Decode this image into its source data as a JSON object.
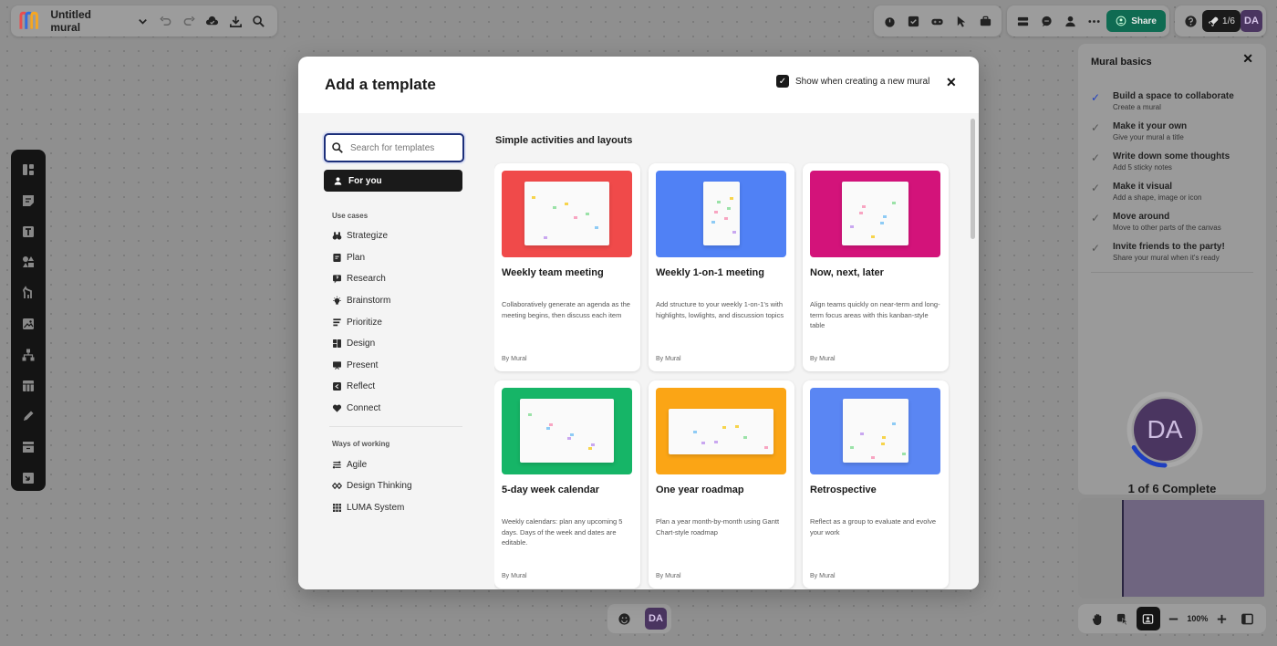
{
  "topbar": {
    "mural_title": "Untitled mural",
    "share_label": "Share",
    "onboarding_progress": "1/6",
    "user_initials": "DA"
  },
  "modal": {
    "title": "Add a template",
    "show_when_label": "Show when creating a new mural",
    "show_when_checked": true,
    "search_placeholder": "Search for templates",
    "for_you_label": "For you",
    "use_cases_label": "Use cases",
    "use_cases": [
      {
        "label": "Strategize",
        "icon": "binoculars-icon"
      },
      {
        "label": "Plan",
        "icon": "plan-icon"
      },
      {
        "label": "Research",
        "icon": "research-icon"
      },
      {
        "label": "Brainstorm",
        "icon": "lightbulb-icon"
      },
      {
        "label": "Prioritize",
        "icon": "bars-icon"
      },
      {
        "label": "Design",
        "icon": "shapes-icon"
      },
      {
        "label": "Present",
        "icon": "presentation-icon"
      },
      {
        "label": "Reflect",
        "icon": "reflect-icon"
      },
      {
        "label": "Connect",
        "icon": "heart-icon"
      }
    ],
    "ways_label": "Ways of working",
    "ways": [
      {
        "label": "Agile",
        "icon": "agile-icon"
      },
      {
        "label": "Design Thinking",
        "icon": "design-thinking-icon"
      },
      {
        "label": "LUMA System",
        "icon": "grid-icon"
      }
    ],
    "section_title": "Simple activities and layouts",
    "templates": [
      {
        "title": "Weekly team meeting",
        "desc": "Collaboratively generate an agenda as the meeting begins, then discuss each item",
        "by": "By Mural",
        "color": "#f04a4a"
      },
      {
        "title": "Weekly 1-on-1 meeting",
        "desc": "Add structure to your weekly 1-on-1's with highlights, lowlights, and discussion topics",
        "by": "By Mural",
        "color": "#5081f5"
      },
      {
        "title": "Now, next, later",
        "desc": "Align teams quickly on near-term and long-term focus areas with this kanban-style table",
        "by": "By Mural",
        "color": "#d3137a"
      },
      {
        "title": "5-day week calendar",
        "desc": "Weekly calendars: plan any upcoming 5 days. Days of the week and dates are editable.",
        "by": "By Mural",
        "color": "#16b567"
      },
      {
        "title": "One year roadmap",
        "desc": "Plan a year month-by-month using Gantt Chart-style roadmap",
        "by": "By Mural",
        "color": "#fba515"
      },
      {
        "title": "Retrospective",
        "desc": "Reflect as a group to evaluate and evolve your work",
        "by": "By Mural",
        "color": "#5a86f3"
      }
    ]
  },
  "basics": {
    "title": "Mural basics",
    "items": [
      {
        "title": "Build a space to collaborate",
        "sub": "Create a mural",
        "done": true
      },
      {
        "title": "Make it your own",
        "sub": "Give your mural a title",
        "done": false
      },
      {
        "title": "Write down some thoughts",
        "sub": "Add 5 sticky notes",
        "done": false
      },
      {
        "title": "Make it visual",
        "sub": "Add a shape, image or icon",
        "done": false
      },
      {
        "title": "Move around",
        "sub": "Move to other parts of the canvas",
        "done": false
      },
      {
        "title": "Invite friends to the party!",
        "sub": "Share your mural when it's ready",
        "done": false
      }
    ],
    "avatar_initials": "DA",
    "complete_text": "1 of 6 Complete",
    "progress_fraction": 0.1667
  },
  "zoom": {
    "level": "100%"
  },
  "bottom": {
    "user_initials": "DA"
  },
  "colors": {
    "accent": "#1c2f7a",
    "share": "#0f6b52",
    "avatar": "#4a3560"
  }
}
